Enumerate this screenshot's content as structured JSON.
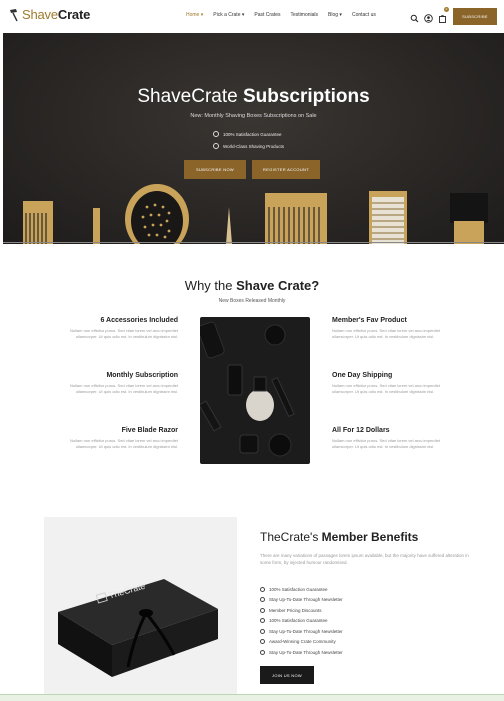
{
  "nav": {
    "logo_part1": "Shave",
    "logo_part2": "Crate",
    "menu": [
      "Home",
      "Pick a Crate",
      "Past Crates",
      "Testimonials",
      "Blog",
      "Contact us"
    ],
    "cart_count": "0",
    "subscribe": "SUBSCRIBE"
  },
  "hero": {
    "title_light": "ShaveCrate",
    "title_bold": "Subscriptions",
    "subtitle": "New: Monthly Shaving Boxes Subscriptions on Sale",
    "checks": [
      "100% Satisfaction Guarantee",
      "World-Class Shaving Products"
    ],
    "btn_subscribe": "SUBSCRIBE NOW",
    "btn_register": "REGISTER ACCOUNT"
  },
  "why": {
    "title_light": "Why the",
    "title_bold": "Shave Crate?",
    "subtitle": "New Boxes Released Monthly",
    "lorem": "Nullam non efficitur purus. Sed vitae lorem vel arcu imperdiet ullamcorper. Ut quis odio est. In vestibulum dignissim nisl.",
    "left": [
      "6 Accessories Included",
      "Monthly Subscription",
      "Five Blade Razor"
    ],
    "right": [
      "Member's Fav Product",
      "One Day Shipping",
      "All For 12 Dollars"
    ]
  },
  "benefits": {
    "box_label": "TheCrate",
    "title_light": "TheCrate's",
    "title_bold": "Member Benefits",
    "desc": "There are many variations of passages lorem ipsum available, but the majority have suffered alteration in some form, by injected humour randomised.",
    "items": [
      "100% Satisfaction Guarantee",
      "Stay Up-To-Date Through Newsletter",
      "Member Pricing Discounts",
      "100% Satisfaction Guarantee",
      "Stay Up-To-Date Through Newsletter",
      "Award-Winning Crate Community",
      "Stay Up-To-Date Through Newsletter"
    ],
    "join": "JOIN US NOW"
  }
}
